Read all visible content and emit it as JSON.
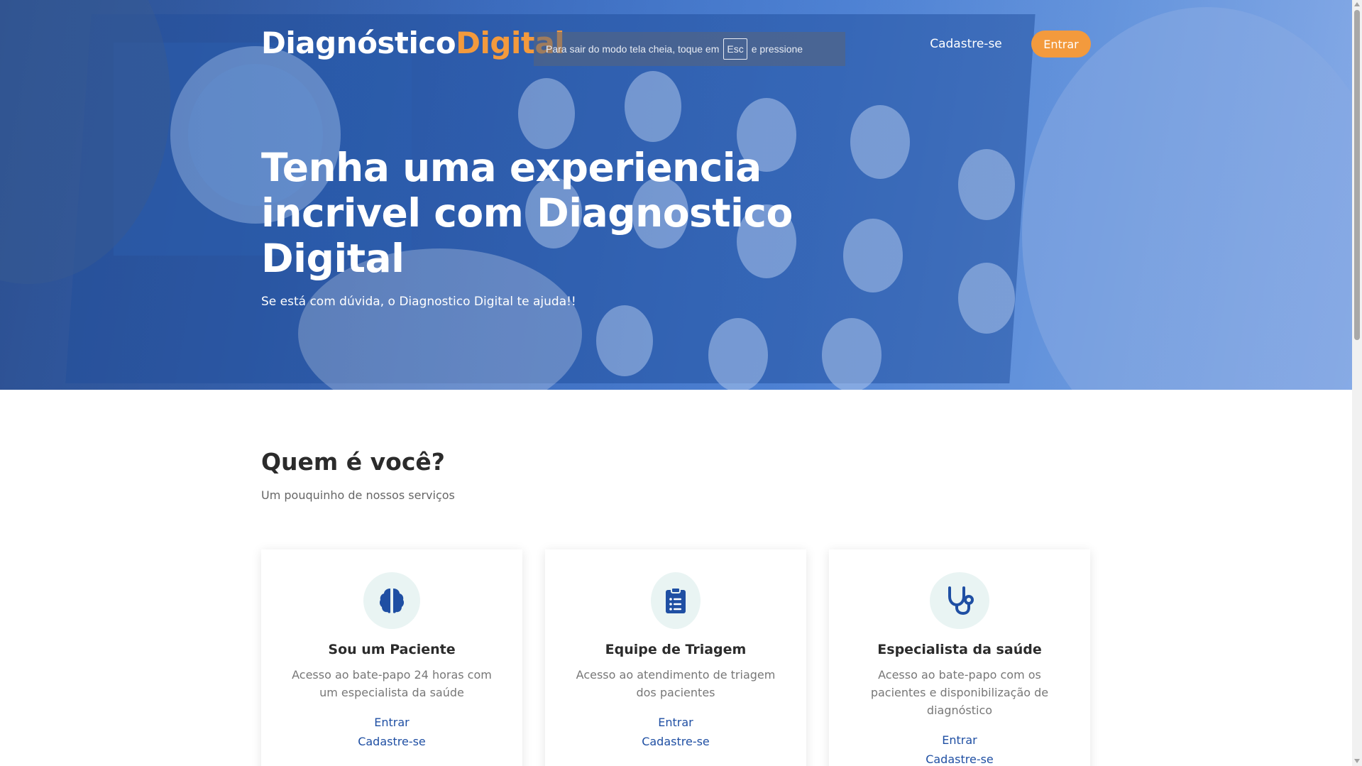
{
  "brand": {
    "part1": "Diagnóstico",
    "part2": "Digital"
  },
  "fullscreen_notice": {
    "before": "Para sair do modo tela cheia, toque em",
    "key": "Esc",
    "after": "e pressione"
  },
  "nav": {
    "signup": "Cadastre-se",
    "login": "Entrar"
  },
  "hero": {
    "title": "Tenha uma experiencia incrivel com Diagnostico Digital",
    "subtitle": "Se está com dúvida, o Diagnostico Digital te ajuda!!"
  },
  "section": {
    "title": "Quem é você?",
    "subtitle": "Um pouquinho de nossos serviços"
  },
  "cards": [
    {
      "icon": "brain-icon",
      "title": "Sou um Paciente",
      "description": "Acesso ao bate-papo 24 horas com um especialista da saúde",
      "login": "Entrar",
      "signup": "Cadastre-se"
    },
    {
      "icon": "clipboard-list-icon",
      "title": "Equipe de Triagem",
      "description": "Acesso ao atendimento de triagem dos pacientes",
      "login": "Entrar",
      "signup": "Cadastre-se"
    },
    {
      "icon": "stethoscope-icon",
      "title": "Especialista da saúde",
      "description": "Acesso ao bate-papo com os pacientes e disponibilização de diagnóstico",
      "login": "Entrar",
      "signup": "Cadastre-se"
    }
  ],
  "colors": {
    "accent": "#f39a3d",
    "link": "#1f4fa3",
    "icon": "#1f4fa3",
    "icon_bg": "#e9f4f3",
    "hero": "#3d6fc2"
  }
}
